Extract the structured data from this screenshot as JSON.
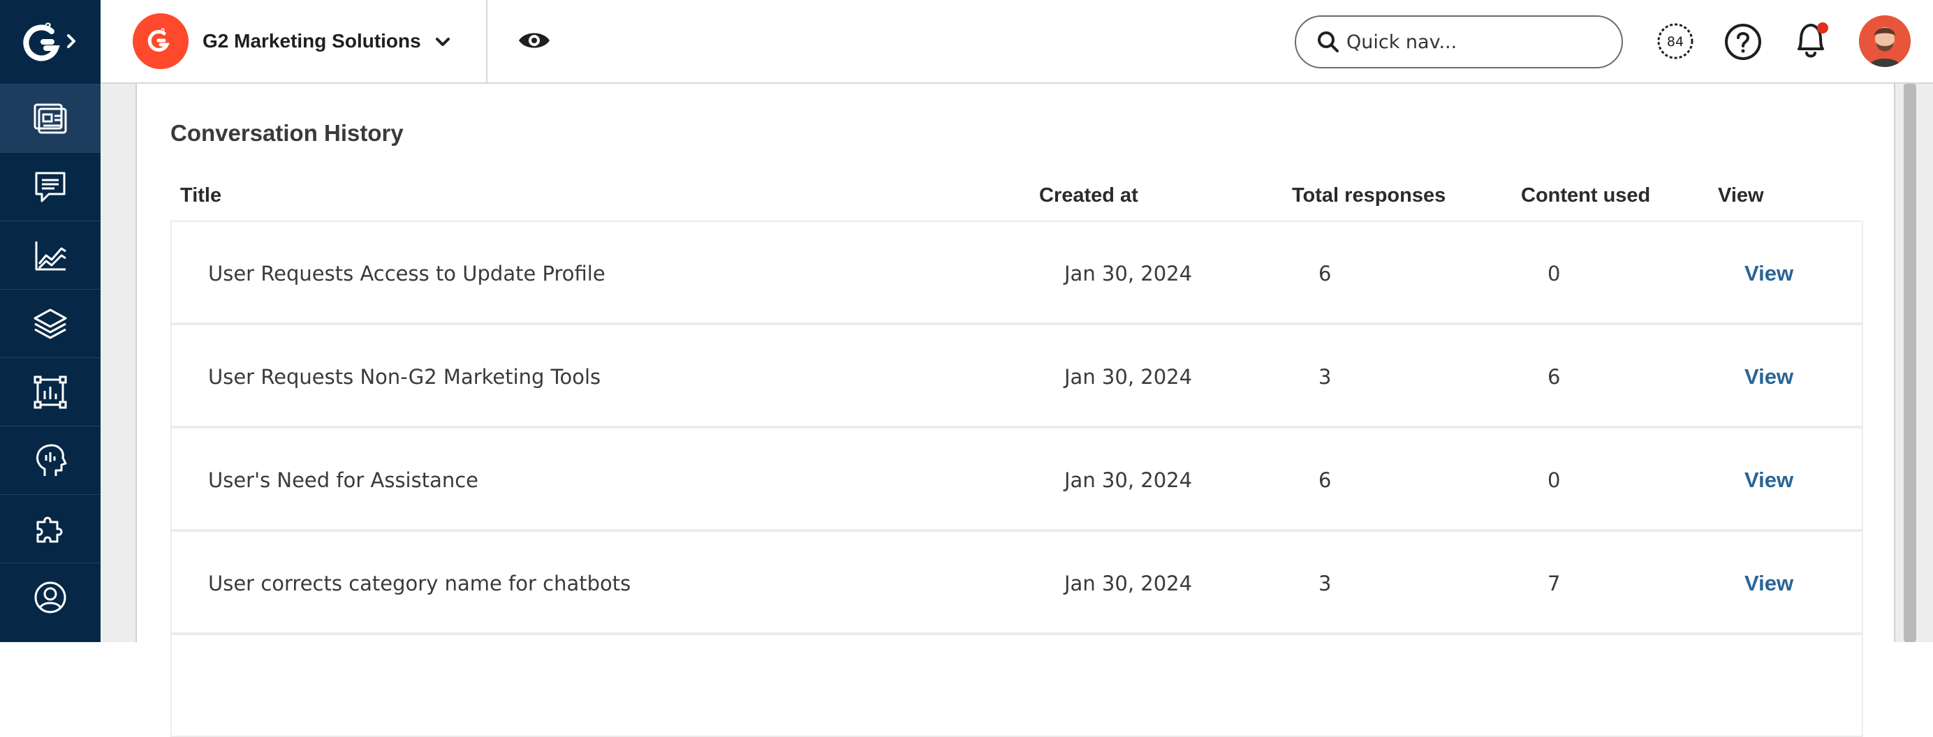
{
  "app": {
    "logo_icon": "g2-logo-icon",
    "brand_color": "#ff492c",
    "rail_color": "#062846"
  },
  "sidebar": {
    "items": [
      {
        "icon": "dashboard-icon",
        "active": true
      },
      {
        "icon": "chat-icon",
        "active": false
      },
      {
        "icon": "chart-line-icon",
        "active": false
      },
      {
        "icon": "layers-icon",
        "active": false
      },
      {
        "icon": "report-frame-icon",
        "active": false
      },
      {
        "icon": "head-insights-icon",
        "active": false
      },
      {
        "icon": "puzzle-icon",
        "active": false
      },
      {
        "icon": "user-circle-icon",
        "active": false
      }
    ]
  },
  "header": {
    "org_name": "G2 Marketing Solutions",
    "search_placeholder": "Quick nav...",
    "score": "84"
  },
  "conversation": {
    "title": "Conversation History",
    "columns": {
      "title": "Title",
      "created_at": "Created at",
      "total_responses": "Total responses",
      "content_used": "Content used",
      "view": "View"
    },
    "rows": [
      {
        "title": "User Requests Access to Update Profile",
        "created_at": "Jan 30, 2024",
        "total_responses": "6",
        "content_used": "0",
        "view": "View"
      },
      {
        "title": "User Requests Non-G2 Marketing Tools",
        "created_at": "Jan 30, 2024",
        "total_responses": "3",
        "content_used": "6",
        "view": "View"
      },
      {
        "title": "User's Need for Assistance",
        "created_at": "Jan 30, 2024",
        "total_responses": "6",
        "content_used": "0",
        "view": "View"
      },
      {
        "title": "User corrects category name for chatbots",
        "created_at": "Jan 30, 2024",
        "total_responses": "3",
        "content_used": "7",
        "view": "View"
      }
    ]
  }
}
